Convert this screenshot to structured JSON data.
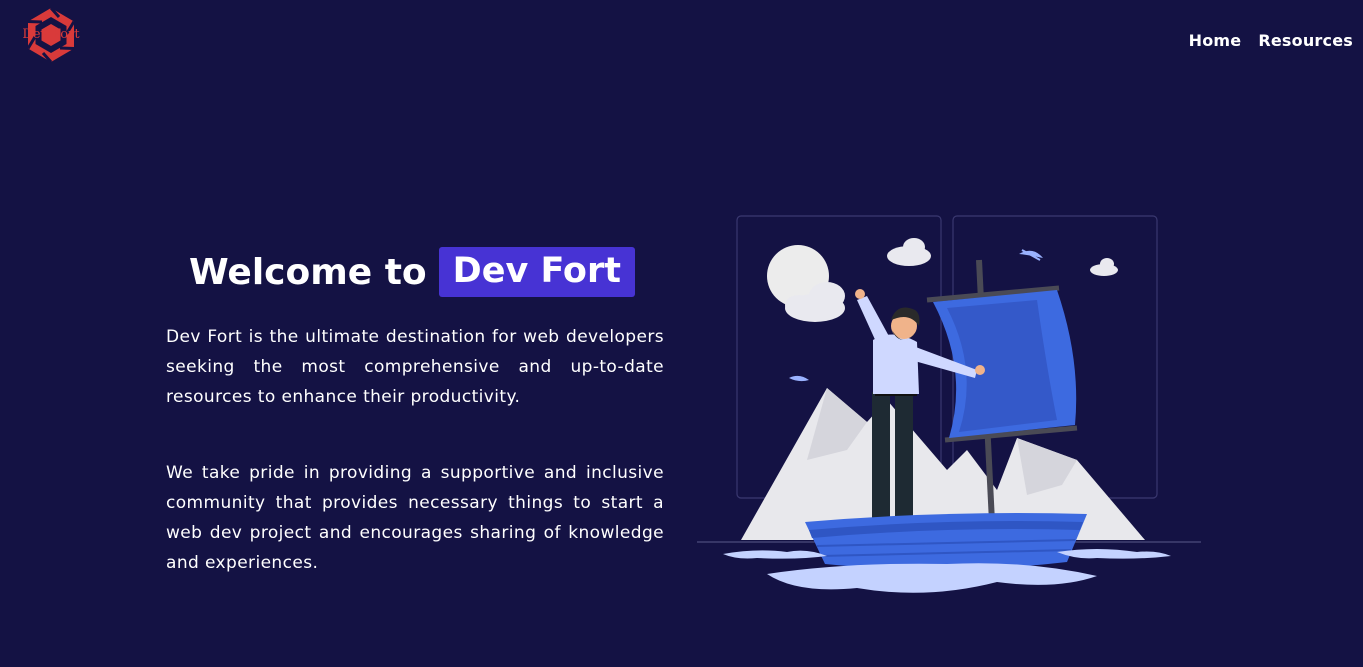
{
  "header": {
    "logo_text": "Dev Fort",
    "nav": [
      {
        "label": "Home"
      },
      {
        "label": "Resources"
      }
    ]
  },
  "hero": {
    "title_prefix": "Welcome to",
    "title_brand": "Dev Fort",
    "paragraph_1": "Dev Fort is the ultimate destination for web developers seeking the most comprehensive and up-to-date resources to enhance their productivity.",
    "paragraph_2": "We take pride in providing a supportive and inclusive community that provides necessary things to start a web dev project and encourages sharing of knowledge and experiences."
  },
  "colors": {
    "background": "#141244",
    "brand_highlight": "#4733d4",
    "logo_red": "#d93a3a",
    "sail_blue": "#3d6ae0"
  },
  "icons": {
    "logo": "dev-fort-logo",
    "illustration": "man-on-sailboat-illustration"
  }
}
